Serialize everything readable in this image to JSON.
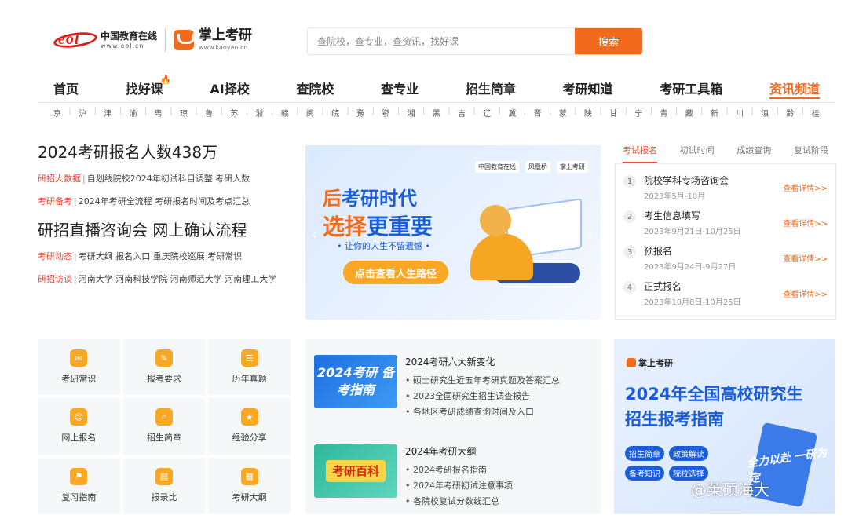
{
  "header": {
    "eol_logo": {
      "mark": "eol",
      "name": "中国教育在线",
      "url_text": "www.eol.cn"
    },
    "kaoyan_logo": {
      "name": "掌上考研",
      "url_text": "www.kaoyan.cn"
    },
    "search": {
      "placeholder": "查院校，查专业，查资讯，找好课",
      "button": "搜索"
    }
  },
  "nav": {
    "items": [
      "首页",
      "找好课",
      "AI择校",
      "查院校",
      "查专业",
      "招生简章",
      "考研知道",
      "考研工具箱",
      "资讯频道"
    ],
    "active_index": 8,
    "hot_icon": "fire-icon"
  },
  "regions": [
    "京",
    "沪",
    "津",
    "渝",
    "粤",
    "琼",
    "鲁",
    "苏",
    "浙",
    "赣",
    "闽",
    "皖",
    "豫",
    "鄂",
    "湘",
    "黑",
    "吉",
    "辽",
    "冀",
    "晋",
    "蒙",
    "陕",
    "甘",
    "宁",
    "青",
    "藏",
    "新",
    "川",
    "滇",
    "黔",
    "桂"
  ],
  "news": {
    "headline1": "2024考研报名人数438万",
    "line1": {
      "tag": "研招大数据",
      "text": "自划线院校2024年初试科目调整 考研人数"
    },
    "line2": {
      "tag": "考研备考",
      "text": "2024年考研全流程 考研报名时间及考点汇总"
    },
    "headline2": "研招直播咨询会 网上确认流程",
    "line3": {
      "tag": "考研动态",
      "text": "考研大纲 报名入口 重庆院校巡展 考研常识"
    },
    "line4": {
      "tag": "研招访谈",
      "text": "河南大学 河南科技学院 河南师范大学 河南理工大学"
    }
  },
  "banner": {
    "logos": [
      "中国教育在线",
      "凤凰桥",
      "掌上考研"
    ],
    "title_a_orange": "后",
    "title_a_blue": "考研时代",
    "title_b_orange": "选择",
    "title_b_blue": "更重要",
    "subtitle": "• 让你的人生不留遗憾 •",
    "cta": "点击查看人生路径",
    "prev": "‹",
    "next": "›"
  },
  "steps": {
    "tabs": [
      "考试报名",
      "初试时间",
      "成绩查询",
      "复试阶段"
    ],
    "active_tab": 0,
    "items": [
      {
        "num": "1",
        "title": "院校学科专场咨询会",
        "date": "2023年5月-10月",
        "link": "查看详情>>"
      },
      {
        "num": "2",
        "title": "考生信息填写",
        "date": "2023年9月21日-10月25日",
        "link": "查看详情>>"
      },
      {
        "num": "3",
        "title": "预报名",
        "date": "2023年9月24日-9月27日",
        "link": "查看详情>>"
      },
      {
        "num": "4",
        "title": "正式报名",
        "date": "2023年10月8日-10月25日",
        "link": "查看详情>>"
      }
    ]
  },
  "grid": [
    {
      "label": "考研常识",
      "icon": "mail-icon"
    },
    {
      "label": "报考要求",
      "icon": "pen-icon"
    },
    {
      "label": "历年真题",
      "icon": "document-icon"
    },
    {
      "label": "网上报名",
      "icon": "user-icon"
    },
    {
      "label": "招生简章",
      "icon": "search-doc-icon"
    },
    {
      "label": "经验分享",
      "icon": "star-icon"
    },
    {
      "label": "复习指南",
      "icon": "flag-icon"
    },
    {
      "label": "报录比",
      "icon": "clipboard-icon"
    },
    {
      "label": "考研大纲",
      "icon": "calendar-icon"
    }
  ],
  "mid": {
    "block1": {
      "thumb": "2024考研 备考指南",
      "head": "2024考研六大新变化",
      "items": [
        "• 硕士研究生近五年考研真题及答案汇总",
        "• 2023全国研究生招生调查报告",
        "• 各地区考研成绩查询时间及入口"
      ]
    },
    "block2": {
      "thumb": "考研百科",
      "head": "2024年考研大纲",
      "items": [
        "• 2024考研报名指南",
        "• 2024年考研初试注意事项",
        "• 各院校复试分数线汇总"
      ]
    }
  },
  "poster": {
    "logo": "掌上考研",
    "title1": "2024年全国高校研究生",
    "title2": "招生报考指南",
    "tags": [
      "招生简章",
      "政策解读",
      "备考知识",
      "院校选择"
    ],
    "slogan": "全力以赴 一研为定"
  },
  "watermark": "@莱硕海大",
  "colors": {
    "accent": "#f26b1d",
    "brand_blue": "#1a5cd9",
    "tag_red": "#e74a3b"
  }
}
